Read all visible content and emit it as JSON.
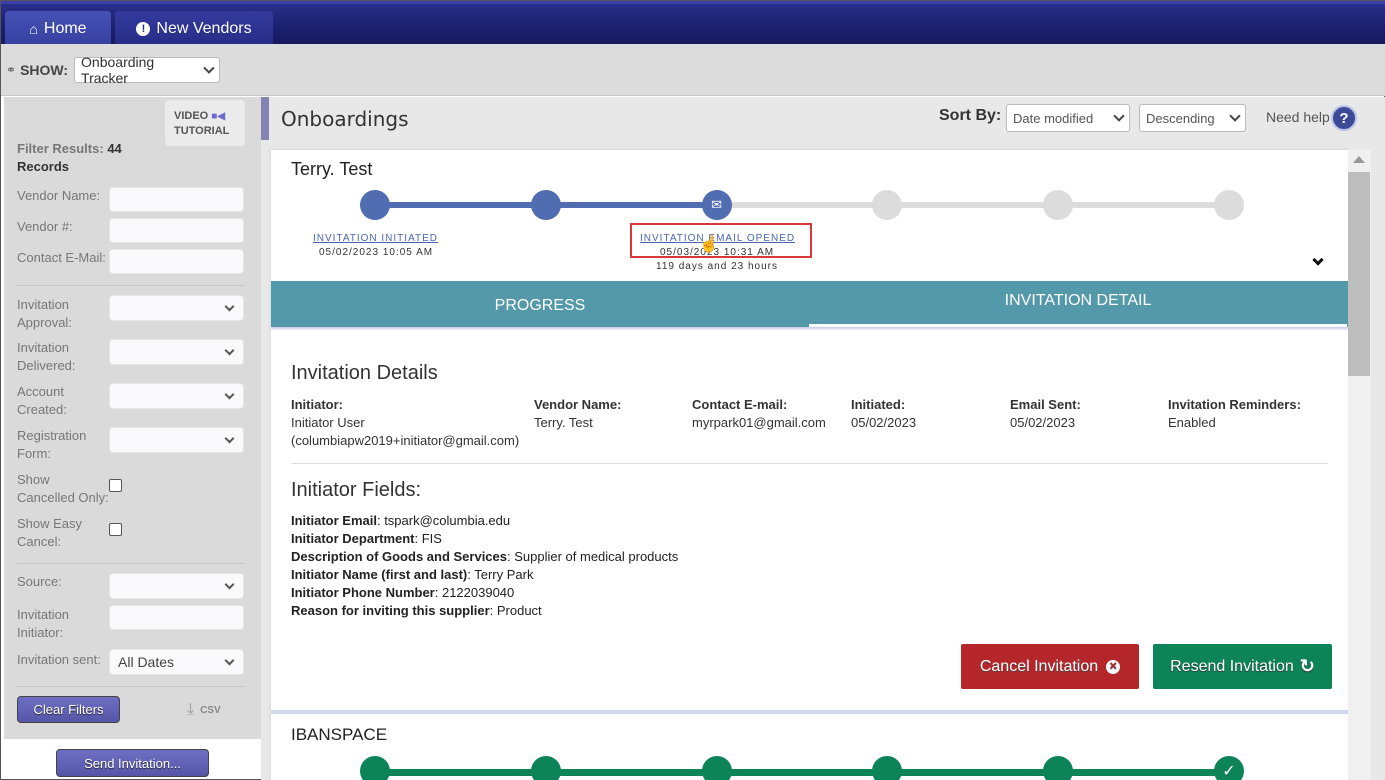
{
  "nav": {
    "tabs": [
      {
        "label": "Home",
        "icon": "home-icon"
      },
      {
        "label": "New Vendors",
        "icon": "exclamation-icon"
      }
    ]
  },
  "showbar": {
    "label": "SHOW:",
    "selected": "Onboarding Tracker"
  },
  "sidebar": {
    "video_tutorial": {
      "line1": "VIDEO",
      "line2": "TUTORIAL"
    },
    "filter_results_label": "Filter Results:",
    "filter_results_count": "44",
    "filter_results_unit": "Records",
    "text_filters": [
      {
        "label": "Vendor Name:",
        "value": ""
      },
      {
        "label": "Vendor #:",
        "value": ""
      },
      {
        "label": "Contact E-Mail:",
        "value": ""
      }
    ],
    "select_filters": [
      {
        "label_1": "Invitation",
        "label_2": "Approval:",
        "value": ""
      },
      {
        "label_1": "Invitation",
        "label_2": "Delivered:",
        "value": ""
      },
      {
        "label_1": "Account",
        "label_2": "Created:",
        "value": ""
      },
      {
        "label_1": "Registration",
        "label_2": "Form:",
        "value": ""
      }
    ],
    "checkbox_filters": [
      {
        "label_1": "Show",
        "label_2": "Cancelled Only:",
        "checked": false
      },
      {
        "label_1": "Show Easy",
        "label_2": "Cancel:",
        "checked": false
      }
    ],
    "source_label": "Source:",
    "source_value": "",
    "initiator_label_1": "Invitation",
    "initiator_label_2": "Initiator:",
    "initiator_value": "",
    "sent_label": "Invitation sent:",
    "sent_value": "All Dates",
    "clear_filters": "Clear Filters",
    "csv": "CSV",
    "send_invitation": "Send Invitation..."
  },
  "main": {
    "title": "Onboardings",
    "sort_by_label": "Sort By:",
    "sort_field": "Date modified",
    "sort_order": "Descending",
    "need_help": "Need help",
    "help_icon_glyph": "?"
  },
  "onboarding": {
    "vendor_name": "Terry. Test",
    "progress": {
      "total_steps": 6,
      "completed_steps": 3,
      "color": "#4f6db0",
      "steps": [
        {
          "label": "INVITATION INITIATED",
          "date": "05/02/2023 10:05 AM",
          "duration": ""
        },
        {
          "label": "",
          "date": "",
          "duration": ""
        },
        {
          "label": "INVITATION EMAIL OPENED",
          "date": "05/03/2023 10:31 AM",
          "duration": "119 days and 23 hours"
        },
        {
          "label": "",
          "date": "",
          "duration": ""
        },
        {
          "label": "",
          "date": "",
          "duration": ""
        },
        {
          "label": "",
          "date": "",
          "duration": ""
        }
      ]
    },
    "tabs": [
      {
        "label": "PROGRESS",
        "active": false
      },
      {
        "label": "INVITATION DETAIL",
        "active": true
      }
    ],
    "details_title": "Invitation Details",
    "details": [
      {
        "key": "Initiator:",
        "value": "Initiator User",
        "value2": "(columbiapw2019+initiator@gmail.com)"
      },
      {
        "key": "Vendor Name:",
        "value": "Terry. Test"
      },
      {
        "key": "Contact E-mail:",
        "value": "myrpark01@gmail.com"
      },
      {
        "key": "Initiated:",
        "value": "05/02/2023"
      },
      {
        "key": "Email Sent:",
        "value": "05/02/2023"
      },
      {
        "key": "Invitation Reminders:",
        "value": "Enabled"
      }
    ],
    "fields_title": "Initiator Fields:",
    "fields": [
      {
        "key": "Initiator Email",
        "value": ": tspark@columbia.edu"
      },
      {
        "key": "Initiator Department",
        "value": ": FIS"
      },
      {
        "key": "Description of Goods and Services",
        "value": ": Supplier of medical products"
      },
      {
        "key": "Initiator Name (first and last)",
        "value": ": Terry Park"
      },
      {
        "key": "Initiator Phone Number",
        "value": ": 2122039040"
      },
      {
        "key": "Reason for inviting this supplier",
        "value": ": Product"
      }
    ],
    "cancel_button": "Cancel Invitation",
    "resend_button": "Resend Invitation"
  },
  "second_onboarding": {
    "vendor_name": "IBANSPACE",
    "progress": {
      "total_steps": 6,
      "completed_steps": 6,
      "color": "#0c8457"
    }
  },
  "colors": {
    "nav": "#1b1f6e",
    "tab_bar": "#5399a9",
    "cancel": "#b5262b",
    "resend": "#0c8457",
    "highlight": "#d93838"
  }
}
